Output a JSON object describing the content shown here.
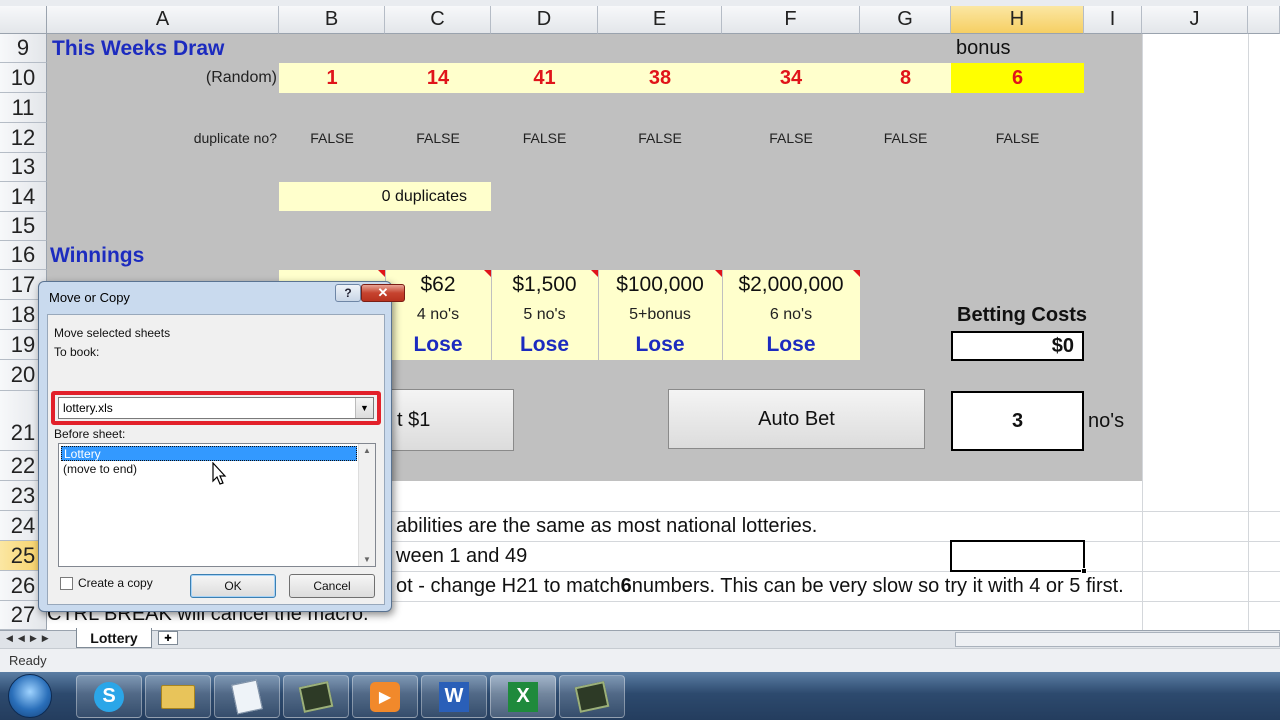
{
  "columns": [
    "A",
    "B",
    "C",
    "D",
    "E",
    "F",
    "G",
    "H",
    "I",
    "J"
  ],
  "rows": [
    "9",
    "10",
    "11",
    "12",
    "13",
    "14",
    "15",
    "16",
    "17",
    "18",
    "19",
    "20",
    "21",
    "22",
    "23",
    "24",
    "25",
    "26",
    "27"
  ],
  "sheet": {
    "draw_title": "This Weeks Draw",
    "bonus_label": "bonus",
    "random_label": "(Random)",
    "numbers": [
      "1",
      "14",
      "41",
      "38",
      "34",
      "8"
    ],
    "bonus_number": "6",
    "duplicate_label": "duplicate no?",
    "duplicate_values": [
      "FALSE",
      "FALSE",
      "FALSE",
      "FALSE",
      "FALSE",
      "FALSE",
      "FALSE"
    ],
    "duplicates_summary": "0 duplicates",
    "winnings_title": "Winnings",
    "prizes": [
      "$62",
      "$1,500",
      "$100,000",
      "$2,000,000"
    ],
    "match_labels": [
      "4 no's",
      "5 no's",
      "5+bonus",
      "6 no's"
    ],
    "results": [
      "Lose",
      "Lose",
      "Lose",
      "Lose"
    ],
    "betting_costs_label": "Betting Costs",
    "betting_costs_value": "$0",
    "bet_button_partial": "t $1",
    "auto_bet_button": "Auto Bet",
    "nos_value": "3",
    "nos_label": "no's",
    "note_line1": "abilities are the same as most national lotteries.",
    "note_line2": "ween 1 and 49",
    "note_line3_pre": "ot - change H21 to match ",
    "note_line3_bold": "6",
    "note_line3_post": " numbers. This can be very slow so try it with 4 or 5 first.",
    "note_line4": "CTRL BREAK will cancel the macro."
  },
  "tabs": {
    "sheet_tab": "Lottery"
  },
  "status": {
    "text": "Ready"
  },
  "dialog": {
    "title": "Move or Copy",
    "help": "?",
    "move_label": "Move selected sheets",
    "to_book_label": "To book:",
    "to_book_value": "lottery.xls",
    "before_sheet_label": "Before sheet:",
    "list_items": [
      "Lottery",
      "(move to end)"
    ],
    "create_copy_label": "Create a copy",
    "ok_label": "OK",
    "cancel_label": "Cancel"
  },
  "taskbar": {
    "apps": [
      "skype-icon",
      "folder-icon",
      "notepad-icon",
      "terminal-icon",
      "media-player-icon",
      "word-icon",
      "excel-icon",
      "recorder-icon"
    ]
  }
}
